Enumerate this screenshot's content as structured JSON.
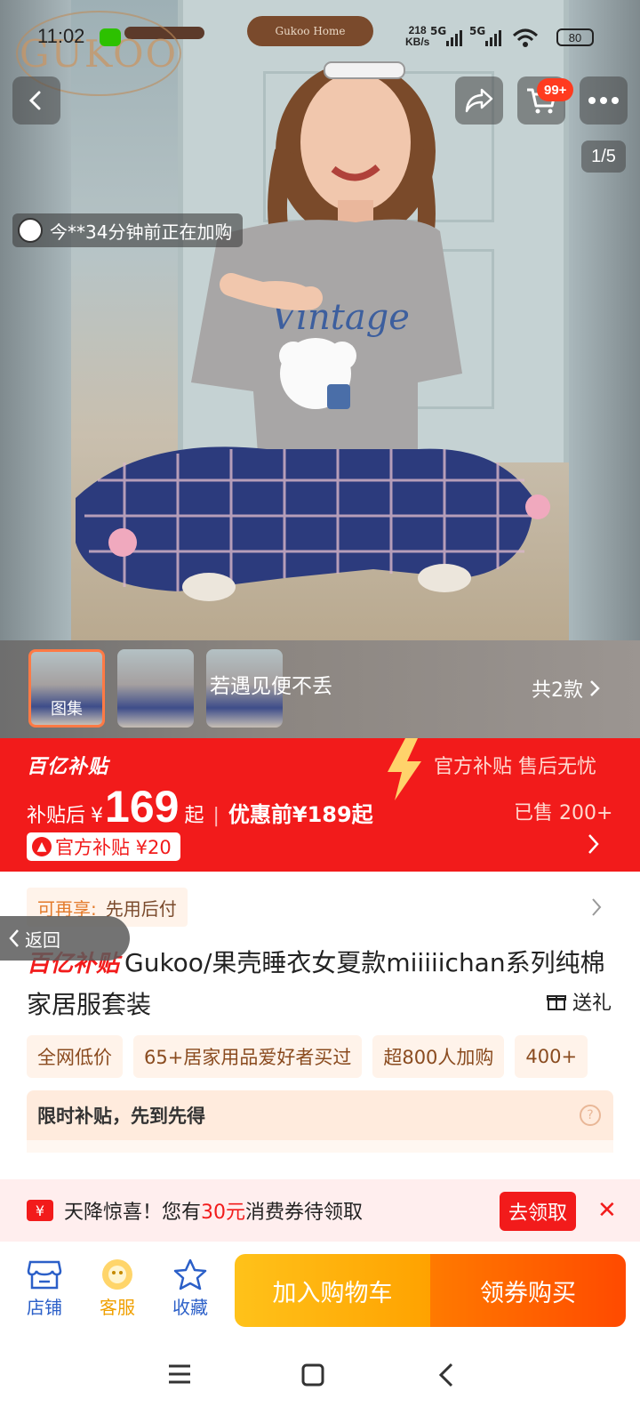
{
  "status_bar": {
    "time": "11:02",
    "net_speed_value": "218",
    "net_speed_unit": "KB/s",
    "sim1": "5G",
    "sim2": "5G",
    "battery": "80"
  },
  "hero": {
    "watermark_brand": "GUKOO",
    "door_sign": "Gukoo Home",
    "cart_badge": "99+",
    "page_indicator": "1/5",
    "activity_text": "今**34分钟前正在加购"
  },
  "gallery": {
    "first_thumb_label": "图集",
    "caption": "若遇见便不丢",
    "variants_label": "共2款"
  },
  "subsidy": {
    "logo": "百亿补贴",
    "guarantee": "官方补贴 售后无忧",
    "price_prefix": "补贴后",
    "currency": "¥",
    "price": "169",
    "price_suffix": "起",
    "original_label": "优惠前¥189起",
    "sold": "已售 200+",
    "coupon": "官方补贴 ¥20"
  },
  "pay_later": {
    "key": "可再享:",
    "value": "先用后付"
  },
  "back_tag": "返回",
  "product": {
    "logo": "百亿补贴",
    "title": "Gukoo/果壳睡衣女夏款miiiiichan系列纯棉家居服套装",
    "gift": "送礼"
  },
  "tags": [
    "全网低价",
    "65+居家用品爱好者买过",
    "超800人加购",
    "400+"
  ],
  "limited": {
    "text": "限时补贴，先到先得",
    "help": "?"
  },
  "voucher": {
    "icon": "¥",
    "prefix": "天降惊喜！您有",
    "amount": "30元",
    "suffix": "消费券待领取",
    "claim": "去领取",
    "close": "✕"
  },
  "actions": {
    "shop": "店铺",
    "service": "客服",
    "favorite": "收藏",
    "add_cart": "加入购物车",
    "buy": "领券购买"
  },
  "colors": {
    "accent_red": "#f21b1b",
    "cart_yellow": "#ffb000",
    "buy_orange": "#ff5a00"
  }
}
